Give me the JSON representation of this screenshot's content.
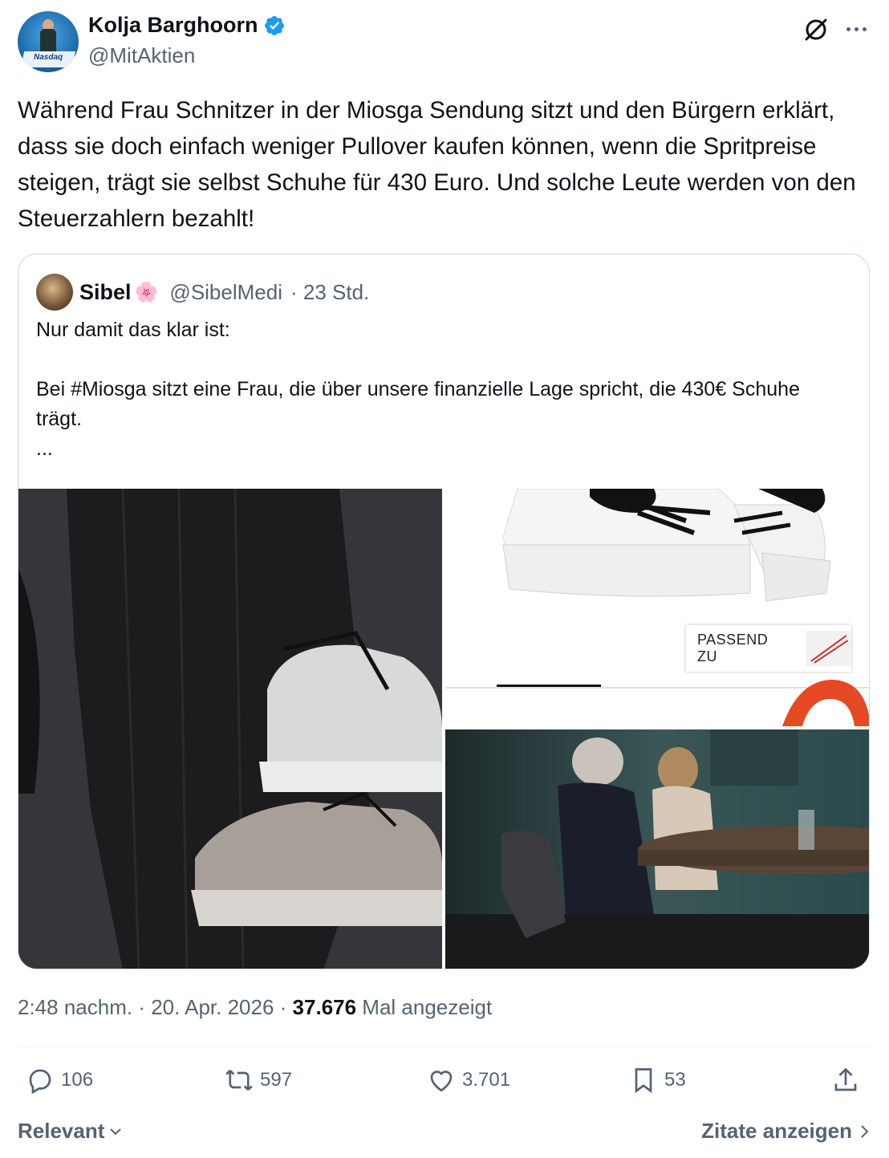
{
  "author": {
    "display_name": "Kolja Barghoorn",
    "handle": "@MitAktien",
    "avatar_text": "Nasdaq"
  },
  "tweet_text": "Während Frau Schnitzer in der Miosga Sendung sitzt und den Bürgern erklärt, dass sie doch einfach weniger Pullover kaufen können, wenn die Spritpreise steigen, trägt sie selbst Schuhe für 430 Euro. Und solche Leute werden von den Steuerzahlern bezahlt!",
  "quote": {
    "display_name": "Sibel",
    "emoji": "🌸",
    "handle": "@SibelMedi",
    "time": "· 23 Std.",
    "text": "Nur damit das klar ist:\n\nBei #Miosga sitzt eine Frau, die über unsere finanzielle Lage spricht, die 430€ Schuhe trägt.\n...",
    "media_caption": "PASSEND ZU"
  },
  "meta": {
    "time": "2:48 nachm. · 20. Apr. 2026 · ",
    "views": "37.676",
    "views_label": " Mal angezeigt"
  },
  "actions": {
    "replies": "106",
    "reposts": "597",
    "likes": "3.701",
    "bookmarks": "53"
  },
  "footer": {
    "sort_label": "Relevant",
    "quotes_label": "Zitate anzeigen"
  },
  "colors": {
    "text_primary": "#0f1419",
    "text_secondary": "#536471",
    "verified_blue": "#1d9bf0",
    "border": "#cfd9de"
  }
}
